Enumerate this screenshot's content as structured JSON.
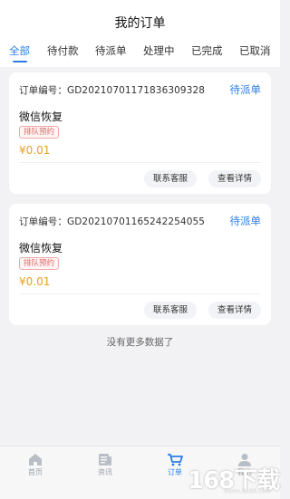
{
  "header": {
    "title": "我的订单"
  },
  "tabs": [
    {
      "label": "全部",
      "active": true
    },
    {
      "label": "待付款",
      "active": false
    },
    {
      "label": "待派单",
      "active": false
    },
    {
      "label": "处理中",
      "active": false
    },
    {
      "label": "已完成",
      "active": false
    },
    {
      "label": "已取消",
      "active": false
    }
  ],
  "orders": [
    {
      "order_no_label": "订单编号：",
      "order_no": "GD20210701171836309328",
      "status": "待派单",
      "service": "微信恢复",
      "badge": "排队预约",
      "price": "¥0.01",
      "contact_button": "联系客服",
      "detail_button": "查看详情"
    },
    {
      "order_no_label": "订单编号：",
      "order_no": "GD20210701165242254055",
      "status": "待派单",
      "service": "微信恢复",
      "badge": "排队预约",
      "price": "¥0.01",
      "contact_button": "联系客服",
      "detail_button": "查看详情"
    }
  ],
  "no_more_text": "没有更多数据了",
  "tabbar": [
    {
      "label": "首页",
      "icon": "home-icon"
    },
    {
      "label": "资讯",
      "icon": "news-icon"
    },
    {
      "label": "订单",
      "icon": "cart-icon",
      "active": true
    },
    {
      "label": "我的",
      "icon": "user-icon"
    }
  ],
  "watermark": {
    "text": "168下载",
    "url": "down.8168.com"
  },
  "colors": {
    "accent": "#2b7ce8",
    "price": "#e7a11e",
    "badge": "#e0696a",
    "background": "#f2f2f4"
  }
}
